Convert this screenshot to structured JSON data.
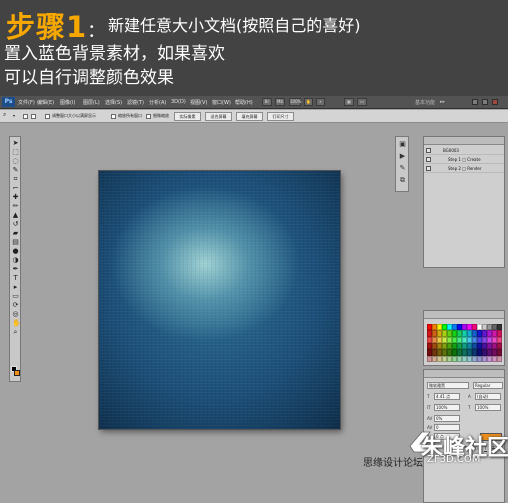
{
  "banner": {
    "step_title": "步骤1",
    "line1": "新建任意大小文档(按照自己的喜好)",
    "line2": "置入蓝色背景素材，如果喜欢",
    "line3": "可以自行调整颜色效果"
  },
  "photoshop": {
    "menu": [
      "文件(F)",
      "编辑(E)",
      "图像(I)",
      "图层(L)",
      "选择(S)",
      "滤镜(T)",
      "分析(A)",
      "3D(D)",
      "视图(V)",
      "窗口(W)",
      "帮助(H)"
    ],
    "zoom_level": "100%",
    "workspace_label": "基本功能",
    "options": {
      "check1_label": "调整窗口大小以满屏显示",
      "check2_label": "缩放所有窗口",
      "check3_label": "细微缩放",
      "buttons": [
        "实际像素",
        "适合屏幕",
        "填充屏幕",
        "打印尺寸"
      ]
    },
    "actions_panel": {
      "set_name": "BG0003",
      "steps": [
        "Step 1 □ Create",
        "Step 2 □ Render"
      ]
    },
    "char_panel": {
      "font_family": "微软雅黑",
      "font_style": "Regular",
      "font_size": "4.41 点",
      "leading": "(自动)",
      "vscale": "100%",
      "hscale": "100%",
      "tracking": "0%",
      "kerning": "0",
      "baseline": "0 点",
      "text_color": "#f08f1b"
    }
  },
  "watermark": {
    "main": "朱峰社区",
    "small": "思缘设计论坛",
    "url": "ZF3D.COM"
  },
  "colors": {
    "banner_bg": "#434343",
    "step_orange": "#f6a800",
    "ps_workspace": "#a3a3a3",
    "canvas_blue_dark": "#0b2238",
    "canvas_blue_light": "#a5d7d7"
  }
}
